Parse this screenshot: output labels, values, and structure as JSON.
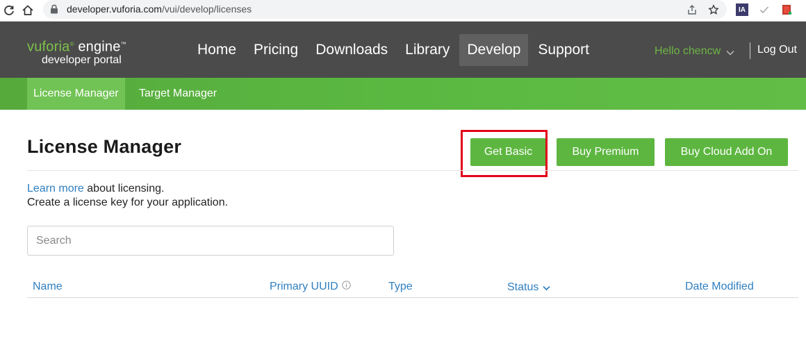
{
  "browser": {
    "url_host": "developer.vuforia.com",
    "url_path": "/vui/develop/licenses",
    "extension_label": "IA"
  },
  "logo": {
    "brand": "vuforia",
    "product": "engine",
    "tm": "™",
    "subtitle": "developer portal"
  },
  "main_nav": {
    "items": [
      {
        "label": "Home"
      },
      {
        "label": "Pricing"
      },
      {
        "label": "Downloads"
      },
      {
        "label": "Library"
      },
      {
        "label": "Develop",
        "active": true
      },
      {
        "label": "Support"
      }
    ]
  },
  "user": {
    "greeting": "Hello chencw",
    "logout_label": "Log Out"
  },
  "sub_nav": {
    "items": [
      {
        "label": "License Manager",
        "active": true
      },
      {
        "label": "Target Manager"
      }
    ]
  },
  "page": {
    "title": "License Manager",
    "buttons": {
      "get_basic": "Get Basic",
      "buy_premium": "Buy Premium",
      "buy_cloud": "Buy Cloud Add On"
    },
    "intro_link": "Learn more",
    "intro_rest": " about licensing.",
    "intro_line2": "Create a license key for your application.",
    "search_placeholder": "Search"
  },
  "table": {
    "columns": [
      {
        "label": "Name"
      },
      {
        "label": "Primary UUID"
      },
      {
        "label": "Type"
      },
      {
        "label": "Status"
      },
      {
        "label": "Date Modified"
      }
    ]
  },
  "colors": {
    "accent_green": "#5db640",
    "header_gray": "#4b4b4b",
    "link_blue": "#2f7fc0",
    "highlight_red": "#e2001a"
  }
}
